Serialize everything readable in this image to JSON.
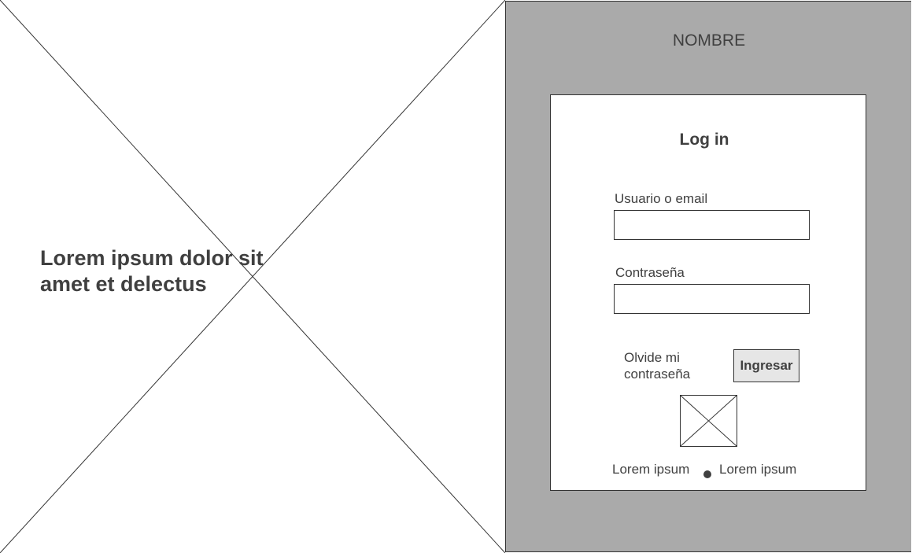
{
  "hero": {
    "image_icon": "image-placeholder-icon",
    "headline": "Lorem ipsum dolor sit amet et delectus"
  },
  "header": {
    "brand_name": "NOMBRE"
  },
  "login": {
    "title": "Log in",
    "username_label": "Usuario o email",
    "username_value": "",
    "password_label": "Contraseña",
    "password_value": "",
    "forgot_password_label": "Olvide mi contraseña",
    "submit_label": "Ingresar",
    "logo_icon": "image-placeholder-icon"
  },
  "footer": {
    "links": [
      "Lorem ipsum",
      "Lorem ipsum"
    ],
    "separator_icon": "bullet-dot-icon"
  },
  "colors": {
    "panel_background": "#aaaaaa",
    "card_background": "#ffffff",
    "text": "#404040",
    "button_background": "#e6e6e6",
    "border": "#333333"
  }
}
